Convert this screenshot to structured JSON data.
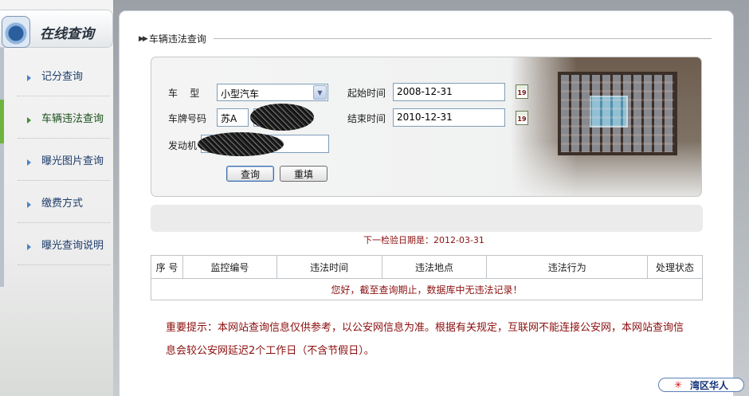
{
  "logo": {
    "title": "在线查询"
  },
  "sidebar": {
    "items": [
      {
        "label": "记分查询"
      },
      {
        "label": "车辆违法查询",
        "active": true
      },
      {
        "label": "曝光图片查询"
      },
      {
        "label": "缴费方式"
      },
      {
        "label": "曝光查询说明"
      }
    ]
  },
  "main": {
    "section_title": "车辆违法查询",
    "form": {
      "vehicle_type_label": "车    型",
      "vehicle_type_value": "小型汽车",
      "plate_label": "车牌号码",
      "plate_prefix": "苏A",
      "engine_label": "发动机",
      "start_label": "起始时间",
      "start_value": "2008-12-31",
      "end_label": "结束时间",
      "end_value": "2010-12-31",
      "calendar_icon_text": "19",
      "query_button": "查询",
      "reset_button": "重填"
    },
    "next_inspection": "下一检验日期是：2012-03-31",
    "table": {
      "headers": [
        "序 号",
        "监控编号",
        "违法时间",
        "违法地点",
        "违法行为",
        "处理状态"
      ],
      "empty_message": "您好，截至查询期止，数据库中无违法记录！"
    },
    "notice": "重要提示：本网站查询信息仅供参考，以公安网信息为准。根据有关规定，互联网不能连接公安网，本网站查询信息会较公安网延迟2个工作日（不含节假日）。"
  },
  "footer": {
    "badge_star": "✳",
    "badge_text": "湾区华人"
  },
  "colors": {
    "accent_red": "#8b1010",
    "menu_blue": "#1f3d6b",
    "active_green": "#6fb33f"
  }
}
